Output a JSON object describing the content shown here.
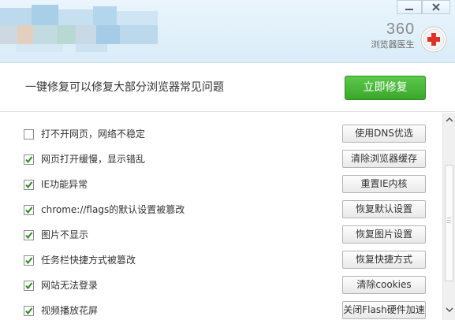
{
  "window": {
    "brand": "360",
    "brand_subtitle": "浏览器医生"
  },
  "icons": {
    "minimize": "minimize-icon",
    "close": "close-icon",
    "doctor": "doctor-cross-icon",
    "checkbox_check": "checkmark-icon",
    "scroll_up": "chevron-up-icon",
    "scroll_down": "chevron-down-icon"
  },
  "colors": {
    "header_bg": "#dcedf9",
    "fix_button": "#44b035",
    "doctor_red": "#e0302a"
  },
  "action": {
    "headline": "一键修复可以修复大部分浏览器常见问题",
    "fix_button": "立即修复"
  },
  "items": [
    {
      "label": "打不开网页，网络不稳定",
      "checked": false,
      "button": "使用DNS优选"
    },
    {
      "label": "网页打开缓慢，显示错乱",
      "checked": true,
      "button": "清除浏览器缓存"
    },
    {
      "label": "IE功能异常",
      "checked": true,
      "button": "重置IE内核"
    },
    {
      "label": "chrome://flags的默认设置被篡改",
      "checked": true,
      "button": "恢复默认设置"
    },
    {
      "label": "图片不显示",
      "checked": true,
      "button": "恢复图片设置"
    },
    {
      "label": "任务栏快捷方式被篡改",
      "checked": true,
      "button": "恢复快捷方式"
    },
    {
      "label": "网站无法登录",
      "checked": true,
      "button": "清除cookies"
    },
    {
      "label": "视频播放花屏",
      "checked": true,
      "button": "关闭Flash硬件加速"
    }
  ]
}
